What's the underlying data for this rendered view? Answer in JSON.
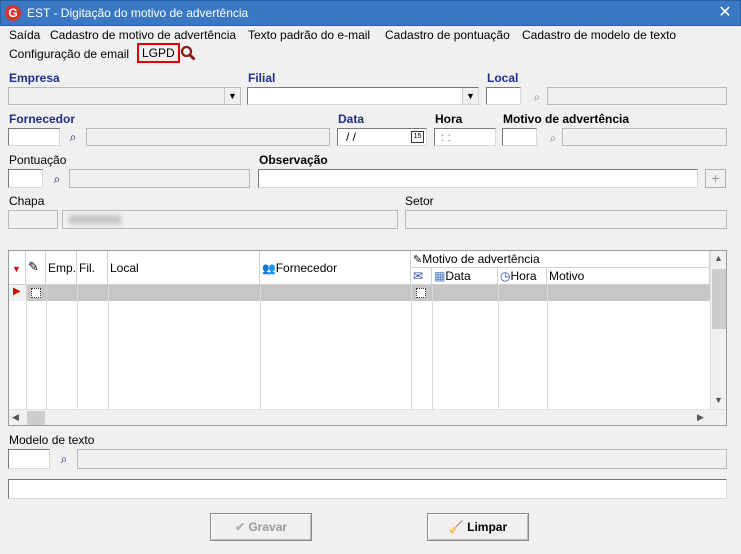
{
  "window": {
    "title": "EST - Digitação do motivo de advertência",
    "icon_letter": "G"
  },
  "menu": {
    "items": [
      "Saída",
      "Cadastro de motivo de advertência",
      "Texto padrão do e-mail",
      "Cadastro de pontuação",
      "Cadastro de modelo de texto"
    ],
    "row2": [
      "Configuração de email",
      "LGPD"
    ]
  },
  "form": {
    "empresa_label": "Empresa",
    "filial_label": "Filial",
    "local_label": "Local",
    "fornecedor_label": "Fornecedor",
    "data_label": "Data",
    "data_value": " / /",
    "hora_label": "Hora",
    "hora_value": " : :",
    "motivo_label": "Motivo de advertência",
    "pontuacao_label": "Pontuação",
    "observacao_label": "Observação",
    "chapa_label": "Chapa",
    "setor_label": "Setor"
  },
  "grid": {
    "headers": {
      "emp": "Emp.",
      "fil": "Fil.",
      "local": "Local",
      "fornecedor": "Fornecedor",
      "motivo_group": "Motivo de advertência",
      "data": "Data",
      "hora": "Hora",
      "motivo": "Motivo"
    }
  },
  "modelo": {
    "label": "Modelo de texto"
  },
  "buttons": {
    "gravar": "Gravar",
    "limpar": "Limpar"
  }
}
